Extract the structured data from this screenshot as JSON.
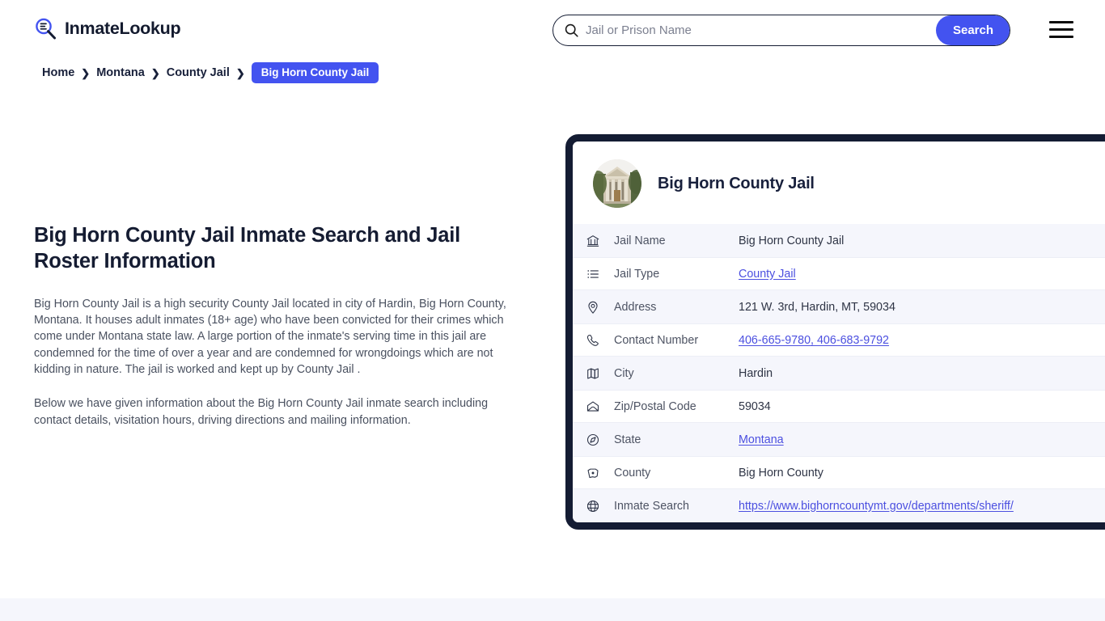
{
  "brand": {
    "name": "InmateLookup",
    "logo_icon": "magnifier-list-icon",
    "accent_color": "#4353f0",
    "dark_color": "#141c33"
  },
  "search": {
    "placeholder": "Jail or Prison Name",
    "value": "",
    "button_label": "Search",
    "icon": "search-icon"
  },
  "menu": {
    "icon": "hamburger-menu-icon"
  },
  "breadcrumb": {
    "items": [
      {
        "label": "Home",
        "active": false
      },
      {
        "label": "Montana",
        "active": false
      },
      {
        "label": "County Jail",
        "active": false
      },
      {
        "label": "Big Horn County Jail",
        "active": true
      }
    ],
    "separator": "❯"
  },
  "main": {
    "title": "Big Horn County Jail Inmate Search and Jail Roster Information",
    "paragraphs": [
      "Big Horn County Jail is a high security County Jail located in city of Hardin, Big Horn County, Montana. It houses adult inmates (18+ age) who have been convicted for their crimes which come under Montana state law. A large portion of the inmate's serving time in this jail are condemned for the time of over a year and are condemned for wrongdoings which are not kidding in nature. The jail is worked and kept up by County Jail .",
      "Below we have given information about the Big Horn County Jail inmate search including contact details, visitation hours, driving directions and mailing information."
    ]
  },
  "card": {
    "title": "Big Horn County Jail",
    "avatar_icon": "courthouse-photo",
    "rows": [
      {
        "icon": "bank-icon",
        "label": "Jail Name",
        "value": "Big Horn County Jail",
        "is_link": false
      },
      {
        "icon": "list-icon",
        "label": "Jail Type",
        "value": "County Jail",
        "is_link": true
      },
      {
        "icon": "map-pin-icon",
        "label": "Address",
        "value": "121 W. 3rd, Hardin, MT, 59034",
        "is_link": false
      },
      {
        "icon": "phone-icon",
        "label": "Contact Number",
        "value": "406-665-9780, 406-683-9792",
        "is_link": true
      },
      {
        "icon": "map-icon",
        "label": "City",
        "value": "Hardin",
        "is_link": false
      },
      {
        "icon": "envelope-icon",
        "label": "Zip/Postal Code",
        "value": "59034",
        "is_link": false
      },
      {
        "icon": "compass-icon",
        "label": "State",
        "value": "Montana",
        "is_link": true
      },
      {
        "icon": "map-county-icon",
        "label": "County",
        "value": "Big Horn County",
        "is_link": false
      },
      {
        "icon": "globe-icon",
        "label": "Inmate Search",
        "value": "https://www.bighorncountymt.gov/departments/sheriff/",
        "is_link": true
      }
    ]
  }
}
